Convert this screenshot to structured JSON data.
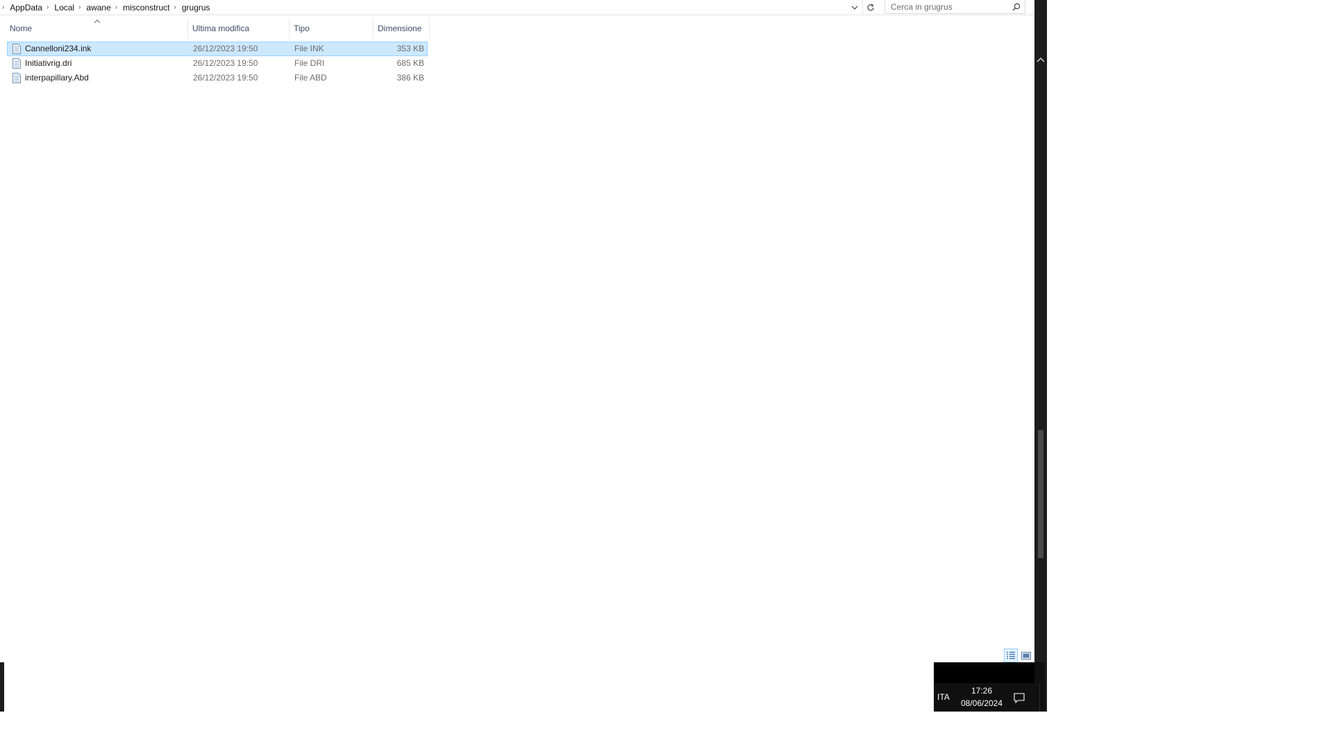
{
  "breadcrumb": {
    "items": [
      "AppData",
      "Local",
      "awane",
      "misconstruct",
      "grugrus"
    ]
  },
  "search": {
    "placeholder": "Cerca in grugrus",
    "value": ""
  },
  "columns": {
    "name": "Nome",
    "modified": "Ultima modifica",
    "type": "Tipo",
    "size": "Dimensione"
  },
  "files": [
    {
      "name": "Cannelloni234.ink",
      "modified": "26/12/2023 19:50",
      "type": "File INK",
      "size": "353 KB",
      "selected": true
    },
    {
      "name": "Initiativrig.dri",
      "modified": "26/12/2023 19:50",
      "type": "File DRI",
      "size": "685 KB",
      "selected": false
    },
    {
      "name": "interpapillary.Abd",
      "modified": "26/12/2023 19:50",
      "type": "File ABD",
      "size": "386 KB",
      "selected": false
    }
  ],
  "tray": {
    "language": "ITA",
    "time": "17:26",
    "date": "08/06/2024"
  },
  "colors": {
    "selection_bg": "#cce8ff",
    "selection_border": "#99d1ff",
    "header_text": "#3b4b66",
    "taskbar": "#101010"
  },
  "icons": {
    "breadcrumb_separator": "chevron-right-icon",
    "dropdown": "chevron-down-icon",
    "refresh": "refresh-icon",
    "search": "search-icon",
    "file": "file-icon",
    "sort": "sort-ascending-icon",
    "details_view": "details-view-icon",
    "tiles_view": "large-icons-view-icon",
    "notifications": "notification-center-icon"
  }
}
